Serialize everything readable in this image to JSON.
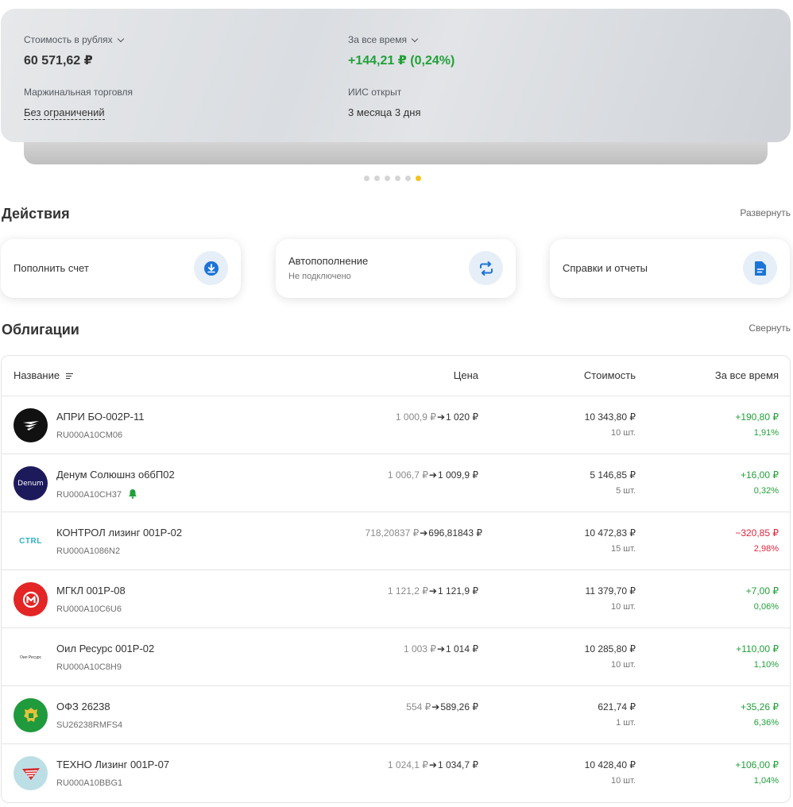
{
  "summary": {
    "value_label": "Стоимость в рублях",
    "value": "60 571,62 ₽",
    "period_label": "За все время",
    "period_value": "+144,21 ₽ (0,24%)",
    "margin_label": "Маржинальная торговля",
    "margin_value": "Без ограничений",
    "iis_label": "ИИС открыт",
    "iis_value": "3 месяца 3 дня",
    "slides_total": 6,
    "active_slide": 6
  },
  "actions": {
    "title": "Действия",
    "expand_label": "Развернуть",
    "items": [
      {
        "label": "Пополнить счет",
        "sub": "",
        "icon": "download-icon"
      },
      {
        "label": "Автопополнение",
        "sub": "Не подключено",
        "icon": "repeat-icon"
      },
      {
        "label": "Справки и отчеты",
        "sub": "",
        "icon": "document-icon"
      }
    ]
  },
  "bonds": {
    "title": "Облигации",
    "collapse_label": "Свернуть",
    "columns": {
      "name": "Название",
      "price": "Цена",
      "cost": "Стоимость",
      "pnl": "За все время"
    },
    "rows": [
      {
        "name": "АПРИ БО-002Р-11",
        "isin": "RU000A10CM06",
        "price_from": "1 000,9 ₽",
        "price_to": "1 020 ₽",
        "cost": "10 343,80 ₽",
        "qty": "10 шт.",
        "pnl": "+190,80 ₽",
        "pnl_pct": "1,91%",
        "positive": true
      },
      {
        "name": "Денум Солюшнз о6бП02",
        "isin": "RU000A10CH37",
        "price_from": "1 006,7 ₽",
        "price_to": "1 009,9 ₽",
        "cost": "5 146,85 ₽",
        "qty": "5 шт.",
        "pnl": "+16,00 ₽",
        "pnl_pct": "0,32%",
        "positive": true,
        "logo_text": "Denum"
      },
      {
        "name": "КОНТРОЛ лизинг 001Р-02",
        "isin": "RU000A1086N2",
        "price_from": "718,20837 ₽",
        "price_to": "696,81843 ₽",
        "cost": "10 472,83 ₽",
        "qty": "15 шт.",
        "pnl": "−320,85 ₽",
        "pnl_pct": "2,98%",
        "positive": false,
        "logo_text": "CTRL"
      },
      {
        "name": "МГКЛ 001Р-08",
        "isin": "RU000A10C6U6",
        "price_from": "1 121,2 ₽",
        "price_to": "1 121,9 ₽",
        "cost": "11 379,70 ₽",
        "qty": "10 шт.",
        "pnl": "+7,00 ₽",
        "pnl_pct": "0,06%",
        "positive": true
      },
      {
        "name": "Оил Ресурс 001Р-02",
        "isin": "RU000A10C8H9",
        "price_from": "1 003 ₽",
        "price_to": "1 014 ₽",
        "cost": "10 285,80 ₽",
        "qty": "10 шт.",
        "pnl": "+110,00 ₽",
        "pnl_pct": "1,10%",
        "positive": true,
        "logo_text": "Оил Ресурс"
      },
      {
        "name": "ОФЗ 26238",
        "isin": "SU26238RMFS4",
        "price_from": "554 ₽",
        "price_to": "589,26 ₽",
        "cost": "621,74 ₽",
        "qty": "1 шт.",
        "pnl": "+35,26 ₽",
        "pnl_pct": "6,36%",
        "positive": true
      },
      {
        "name": "ТЕХНО Лизинг 001Р-07",
        "isin": "RU000A10BBG1",
        "price_from": "1 024,1 ₽",
        "price_to": "1 034,7 ₽",
        "cost": "10 428,40 ₽",
        "qty": "10 шт.",
        "pnl": "+106,00 ₽",
        "pnl_pct": "1,04%",
        "positive": true
      }
    ]
  },
  "colors": {
    "positive": "#21a038",
    "negative": "#e3243b",
    "accent": "#f5c21a",
    "icon_blue": "#1c74d8"
  }
}
